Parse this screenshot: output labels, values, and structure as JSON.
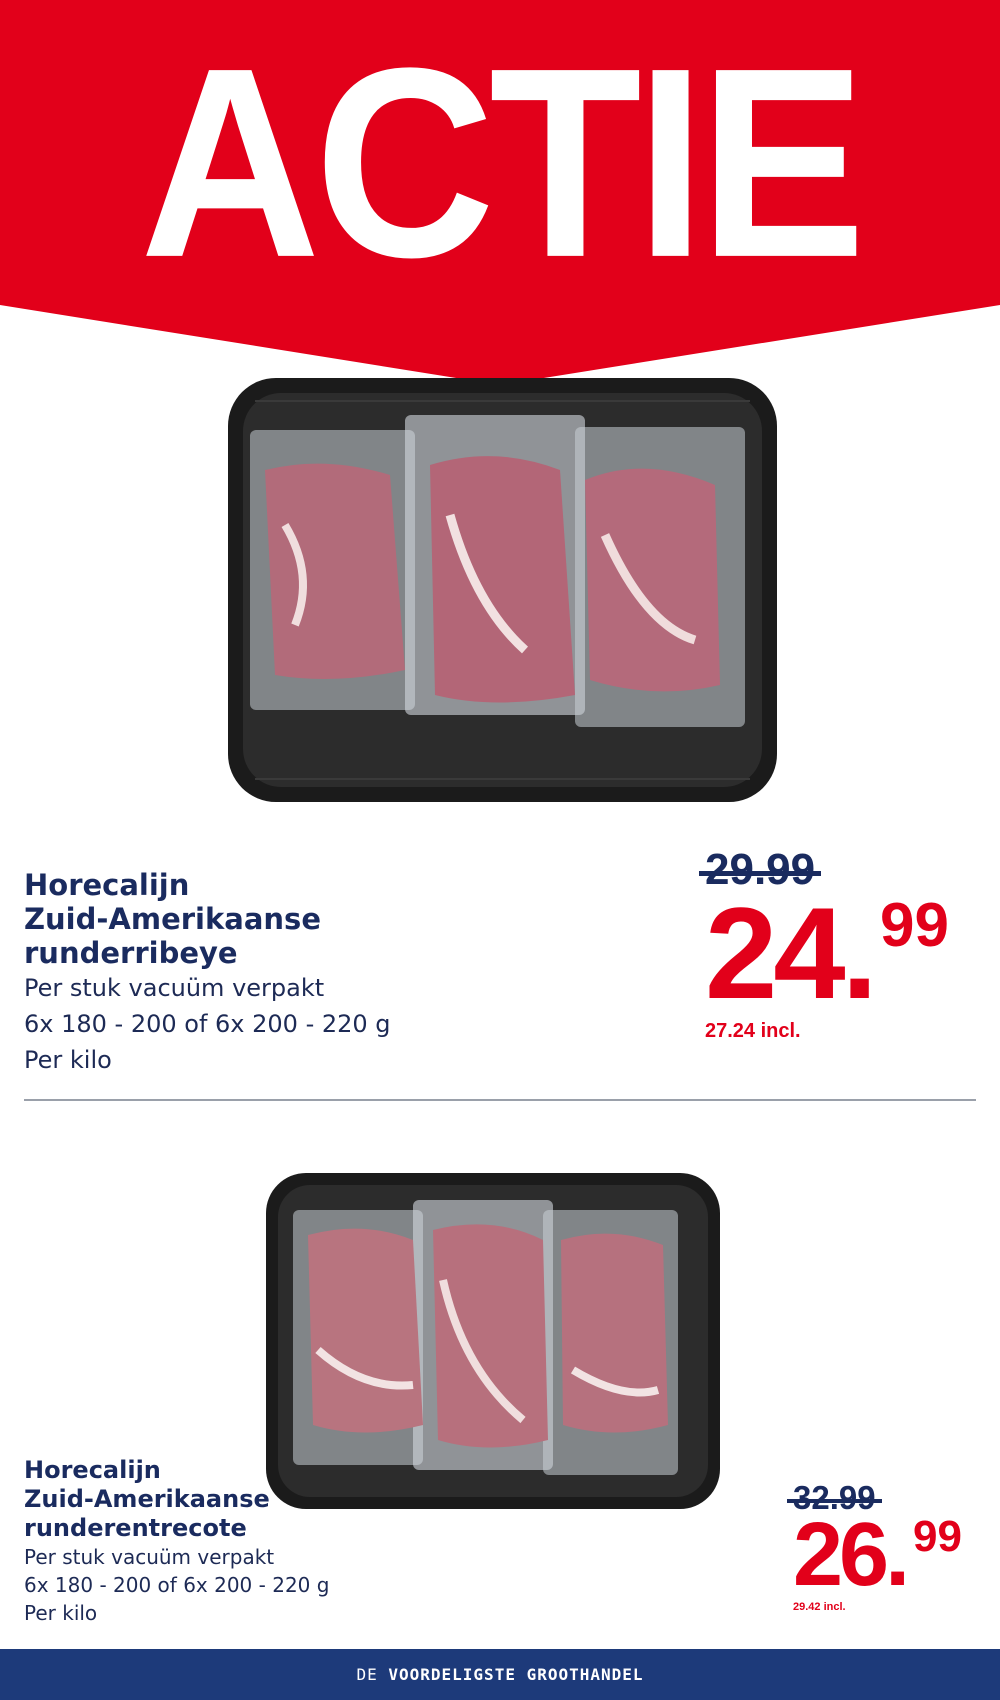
{
  "banner": {
    "title": "ACTIE",
    "color": "#e2001a"
  },
  "products": [
    {
      "name_lines": [
        "Horecalijn",
        "Zuid-Amerikaanse",
        "runderribeye"
      ],
      "desc_lines": [
        "Per stuk vacuüm verpakt",
        "6x 180 - 200 of 6x 200 - 220 g",
        "Per kilo"
      ],
      "old_price": "29.99",
      "price_euros": "24",
      "price_cents": "99",
      "incl": "27.24 incl.",
      "image_icon": "vacuum-packed-steak-tray"
    },
    {
      "name_lines": [
        "Horecalijn",
        "Zuid-Amerikaanse",
        "runderentrecote"
      ],
      "desc_lines": [
        "Per stuk vacuüm verpakt",
        "6x 180 - 200 of 6x 200 - 220 g",
        "Per kilo"
      ],
      "old_price": "32.99",
      "price_euros": "26",
      "price_cents": "99",
      "incl": "29.42 incl.",
      "image_icon": "vacuum-packed-steak-tray"
    }
  ],
  "footer": {
    "prefix": "DE ",
    "tagline": "VOORDELIGSTE GROOTHANDEL",
    "background": "#1d3a7a"
  },
  "colors": {
    "price_red": "#e2001a",
    "navy": "#1a2b5f"
  }
}
